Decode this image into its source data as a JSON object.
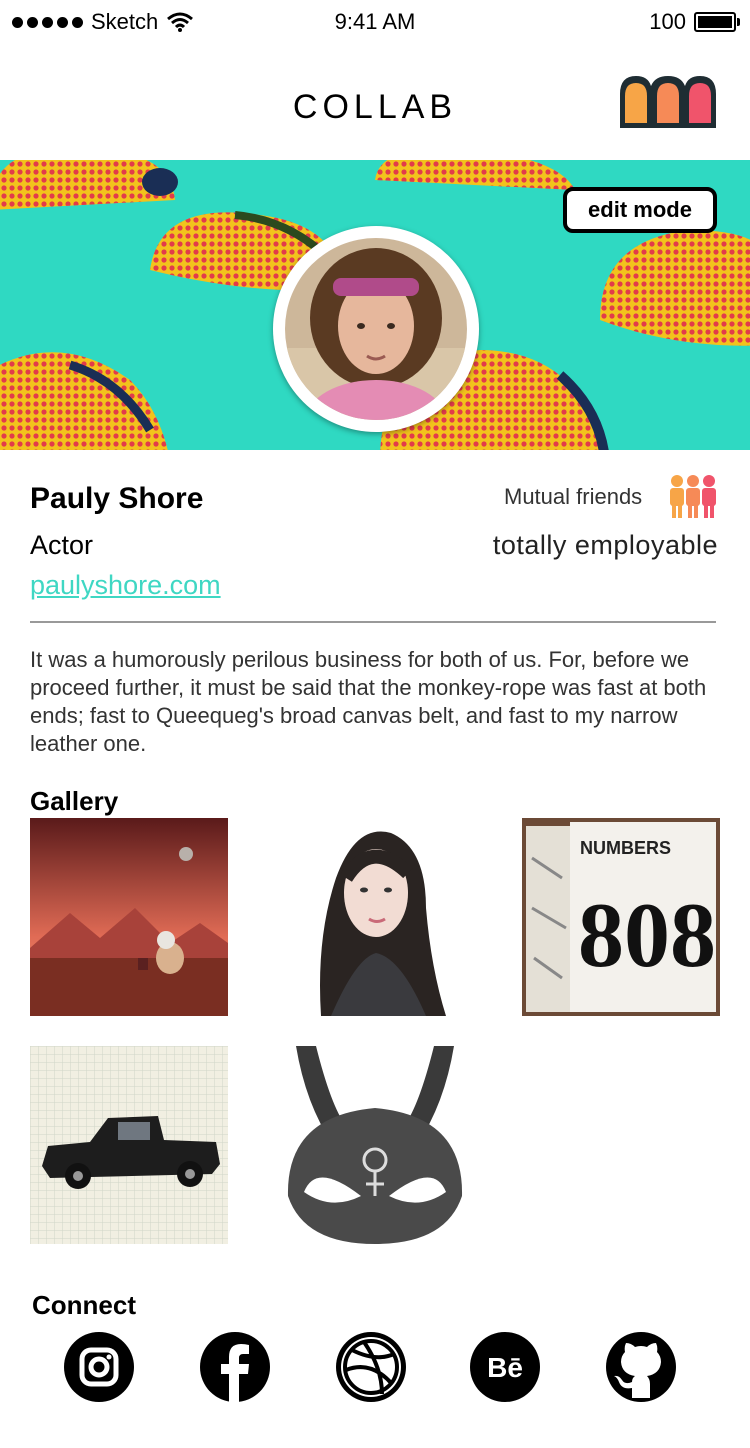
{
  "status_bar": {
    "carrier": "Sketch",
    "time": "9:41 AM",
    "battery": "100"
  },
  "header": {
    "title": "COLLAB",
    "logo_icon": "collab-logo-icon"
  },
  "cover": {
    "edit_label": "edit mode",
    "colors": {
      "background": "#2fd9c2",
      "taco_shell": "#f2c31c",
      "taco_filling": "#e23b4a"
    }
  },
  "profile": {
    "name": "Pauly Shore",
    "occupation": "Actor",
    "website": "paulyshore.com",
    "mutual_friends_label": "Mutual friends",
    "status": "totally employable",
    "bio": "It was a humorously perilous business for both of us. For, before we proceed further, it must be said that the monkey-rope was fast at both ends; fast to Queequeg's broad canvas belt, and fast to my narrow leather one."
  },
  "gallery": {
    "title": "Gallery",
    "items": [
      {
        "name": "mars-astronaut-painting"
      },
      {
        "name": "woman-portrait-sketch"
      },
      {
        "name": "numbers-sketchbook"
      },
      {
        "name": "black-pickup-truck"
      },
      {
        "name": "rabbit-mask-drawing"
      }
    ],
    "numbers_text": "NUMBERS",
    "numbers_digits": "808"
  },
  "connect": {
    "title": "Connect",
    "links": [
      "instagram-icon",
      "facebook-icon",
      "dribbble-icon",
      "behance-icon",
      "github-icon"
    ],
    "behance_text": "Bē"
  },
  "colors": {
    "accent": "#3fd7c3",
    "logo_dark": "#1f2d33",
    "logo_orange": "#f7a547",
    "logo_pink": "#f0546b"
  }
}
